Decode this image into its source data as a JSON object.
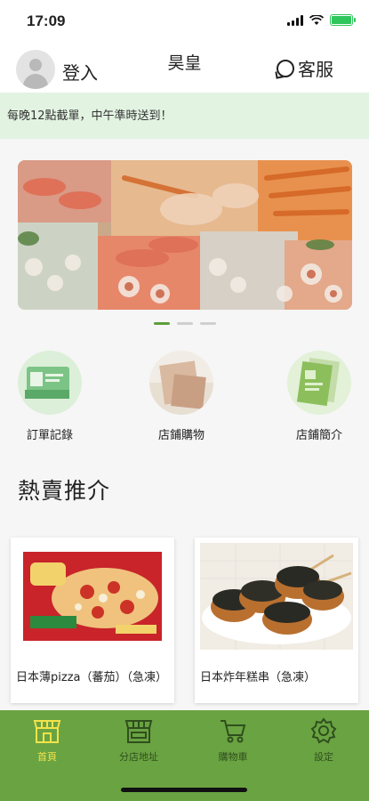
{
  "status_bar": {
    "time": "17:09"
  },
  "header": {
    "login_label": "登入",
    "shop_name": "昊皇",
    "service_label": "客服"
  },
  "notice": {
    "text": "每晚12點截單，中午準時送到！"
  },
  "banner": {
    "slides": 3,
    "active_slide": 1
  },
  "quick_menu": [
    {
      "label": "訂單記錄",
      "icon": "order-record-icon"
    },
    {
      "label": "店鋪購物",
      "icon": "store-shopping-icon"
    },
    {
      "label": "店鋪簡介",
      "icon": "store-intro-icon"
    }
  ],
  "hot": {
    "title": "熱賣推介",
    "products": [
      {
        "name": "日本薄pizza（蕃茄）（急凍）",
        "image": "pizza-box-image"
      },
      {
        "name": "日本炸年糕串（急凍）",
        "image": "fried-rice-cake-skewer-image"
      }
    ]
  },
  "tabbar": {
    "items": [
      {
        "label": "首頁",
        "icon": "home-store-icon",
        "active": true
      },
      {
        "label": "分店地址",
        "icon": "branch-store-icon",
        "active": false
      },
      {
        "label": "購物車",
        "icon": "cart-icon",
        "active": false
      },
      {
        "label": "設定",
        "icon": "gear-icon",
        "active": false
      }
    ]
  },
  "colors": {
    "brand_green": "#6aa342",
    "notice_bg": "#e2f3e2",
    "active_tab": "#f3e34a"
  }
}
